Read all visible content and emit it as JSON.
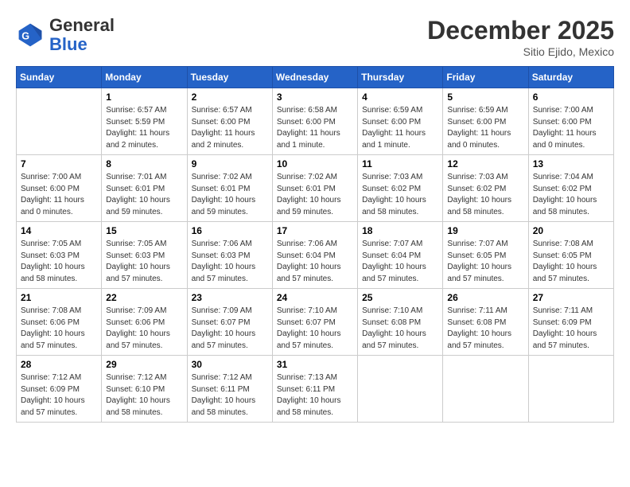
{
  "header": {
    "logo_general": "General",
    "logo_blue": "Blue",
    "month_year": "December 2025",
    "location": "Sitio Ejido, Mexico"
  },
  "days_of_week": [
    "Sunday",
    "Monday",
    "Tuesday",
    "Wednesday",
    "Thursday",
    "Friday",
    "Saturday"
  ],
  "weeks": [
    [
      {
        "day": "",
        "info": ""
      },
      {
        "day": "1",
        "info": "Sunrise: 6:57 AM\nSunset: 5:59 PM\nDaylight: 11 hours\nand 2 minutes."
      },
      {
        "day": "2",
        "info": "Sunrise: 6:57 AM\nSunset: 6:00 PM\nDaylight: 11 hours\nand 2 minutes."
      },
      {
        "day": "3",
        "info": "Sunrise: 6:58 AM\nSunset: 6:00 PM\nDaylight: 11 hours\nand 1 minute."
      },
      {
        "day": "4",
        "info": "Sunrise: 6:59 AM\nSunset: 6:00 PM\nDaylight: 11 hours\nand 1 minute."
      },
      {
        "day": "5",
        "info": "Sunrise: 6:59 AM\nSunset: 6:00 PM\nDaylight: 11 hours\nand 0 minutes."
      },
      {
        "day": "6",
        "info": "Sunrise: 7:00 AM\nSunset: 6:00 PM\nDaylight: 11 hours\nand 0 minutes."
      }
    ],
    [
      {
        "day": "7",
        "info": "Sunrise: 7:00 AM\nSunset: 6:00 PM\nDaylight: 11 hours\nand 0 minutes."
      },
      {
        "day": "8",
        "info": "Sunrise: 7:01 AM\nSunset: 6:01 PM\nDaylight: 10 hours\nand 59 minutes."
      },
      {
        "day": "9",
        "info": "Sunrise: 7:02 AM\nSunset: 6:01 PM\nDaylight: 10 hours\nand 59 minutes."
      },
      {
        "day": "10",
        "info": "Sunrise: 7:02 AM\nSunset: 6:01 PM\nDaylight: 10 hours\nand 59 minutes."
      },
      {
        "day": "11",
        "info": "Sunrise: 7:03 AM\nSunset: 6:02 PM\nDaylight: 10 hours\nand 58 minutes."
      },
      {
        "day": "12",
        "info": "Sunrise: 7:03 AM\nSunset: 6:02 PM\nDaylight: 10 hours\nand 58 minutes."
      },
      {
        "day": "13",
        "info": "Sunrise: 7:04 AM\nSunset: 6:02 PM\nDaylight: 10 hours\nand 58 minutes."
      }
    ],
    [
      {
        "day": "14",
        "info": "Sunrise: 7:05 AM\nSunset: 6:03 PM\nDaylight: 10 hours\nand 58 minutes."
      },
      {
        "day": "15",
        "info": "Sunrise: 7:05 AM\nSunset: 6:03 PM\nDaylight: 10 hours\nand 57 minutes."
      },
      {
        "day": "16",
        "info": "Sunrise: 7:06 AM\nSunset: 6:03 PM\nDaylight: 10 hours\nand 57 minutes."
      },
      {
        "day": "17",
        "info": "Sunrise: 7:06 AM\nSunset: 6:04 PM\nDaylight: 10 hours\nand 57 minutes."
      },
      {
        "day": "18",
        "info": "Sunrise: 7:07 AM\nSunset: 6:04 PM\nDaylight: 10 hours\nand 57 minutes."
      },
      {
        "day": "19",
        "info": "Sunrise: 7:07 AM\nSunset: 6:05 PM\nDaylight: 10 hours\nand 57 minutes."
      },
      {
        "day": "20",
        "info": "Sunrise: 7:08 AM\nSunset: 6:05 PM\nDaylight: 10 hours\nand 57 minutes."
      }
    ],
    [
      {
        "day": "21",
        "info": "Sunrise: 7:08 AM\nSunset: 6:06 PM\nDaylight: 10 hours\nand 57 minutes."
      },
      {
        "day": "22",
        "info": "Sunrise: 7:09 AM\nSunset: 6:06 PM\nDaylight: 10 hours\nand 57 minutes."
      },
      {
        "day": "23",
        "info": "Sunrise: 7:09 AM\nSunset: 6:07 PM\nDaylight: 10 hours\nand 57 minutes."
      },
      {
        "day": "24",
        "info": "Sunrise: 7:10 AM\nSunset: 6:07 PM\nDaylight: 10 hours\nand 57 minutes."
      },
      {
        "day": "25",
        "info": "Sunrise: 7:10 AM\nSunset: 6:08 PM\nDaylight: 10 hours\nand 57 minutes."
      },
      {
        "day": "26",
        "info": "Sunrise: 7:11 AM\nSunset: 6:08 PM\nDaylight: 10 hours\nand 57 minutes."
      },
      {
        "day": "27",
        "info": "Sunrise: 7:11 AM\nSunset: 6:09 PM\nDaylight: 10 hours\nand 57 minutes."
      }
    ],
    [
      {
        "day": "28",
        "info": "Sunrise: 7:12 AM\nSunset: 6:09 PM\nDaylight: 10 hours\nand 57 minutes."
      },
      {
        "day": "29",
        "info": "Sunrise: 7:12 AM\nSunset: 6:10 PM\nDaylight: 10 hours\nand 58 minutes."
      },
      {
        "day": "30",
        "info": "Sunrise: 7:12 AM\nSunset: 6:11 PM\nDaylight: 10 hours\nand 58 minutes."
      },
      {
        "day": "31",
        "info": "Sunrise: 7:13 AM\nSunset: 6:11 PM\nDaylight: 10 hours\nand 58 minutes."
      },
      {
        "day": "",
        "info": ""
      },
      {
        "day": "",
        "info": ""
      },
      {
        "day": "",
        "info": ""
      }
    ]
  ]
}
